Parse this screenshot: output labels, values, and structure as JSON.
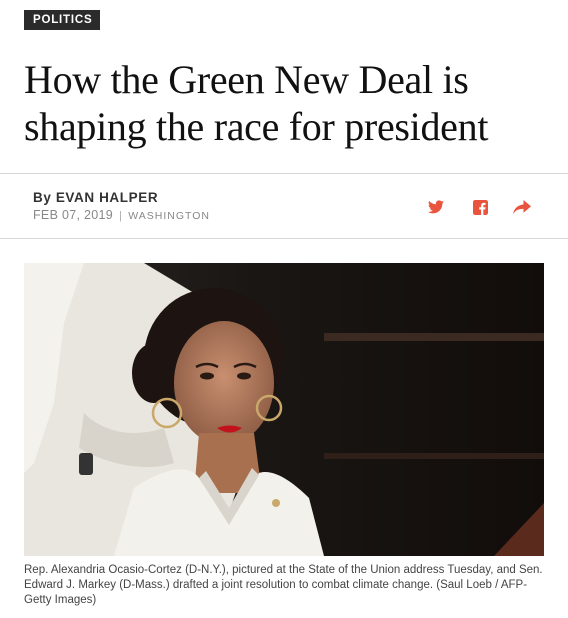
{
  "section_tag": "POLITICS",
  "headline": "How the Green New Deal is shaping the race for president",
  "byline": {
    "prefix": "By",
    "author": "EVAN HALPER",
    "date": "FEB 07, 2019",
    "separator": "|",
    "location": "WASHINGTON"
  },
  "share": {
    "icons": [
      "twitter-icon",
      "facebook-icon",
      "share-arrow-icon"
    ],
    "accent_color": "#e8543e"
  },
  "photo": {
    "caption": "Rep. Alexandria Ocasio-Cortez (D-N.Y.), pictured at the State of the Union address Tuesday, and Sen. Edward J. Markey (D-Mass.) drafted a joint resolution to combat climate change. (Saul Loeb / AFP-Getty Images)"
  }
}
